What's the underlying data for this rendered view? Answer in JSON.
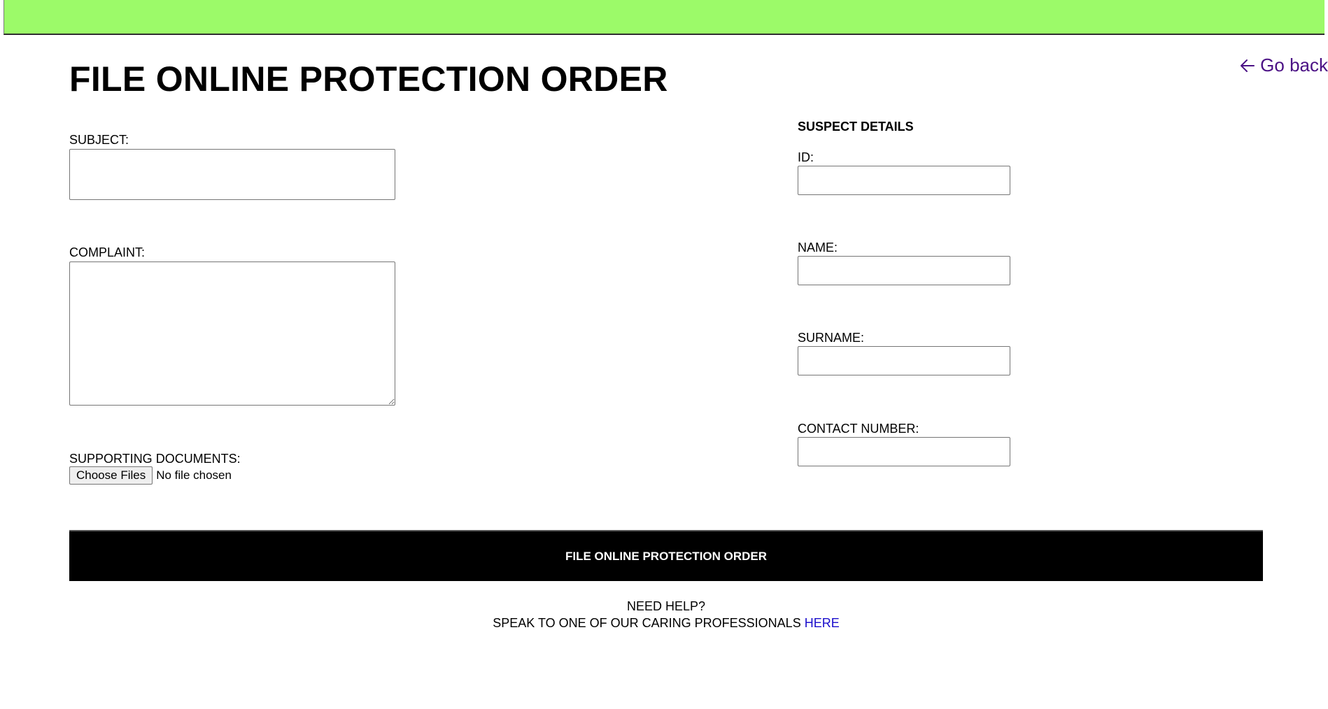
{
  "header": {
    "bar_color": "#9cfa69",
    "title": "FILE ONLINE PROTECTION ORDER",
    "go_back_label": "Go back",
    "go_back_icon": "arrow-left-icon",
    "go_back_color": "#4b1185"
  },
  "form": {
    "subject": {
      "label": "SUBJECT:",
      "value": ""
    },
    "complaint": {
      "label": "COMPLAINT:",
      "value": ""
    },
    "supporting_documents": {
      "label": "SUPPORTING DOCUMENTS:",
      "button_label": "Choose Files",
      "status": "No file chosen"
    },
    "suspect": {
      "heading": "SUSPECT DETAILS",
      "id": {
        "label": "ID:",
        "value": ""
      },
      "name": {
        "label": "NAME:",
        "value": ""
      },
      "surname": {
        "label": "SURNAME:",
        "value": ""
      },
      "contact_number": {
        "label": "CONTACT NUMBER:",
        "value": ""
      }
    },
    "submit_label": "FILE ONLINE PROTECTION ORDER"
  },
  "help": {
    "question": "NEED HELP?",
    "text": "SPEAK TO ONE OF OUR CARING PROFESSIONALS",
    "link_label": "HERE",
    "link_color": "#1a0dcc"
  }
}
